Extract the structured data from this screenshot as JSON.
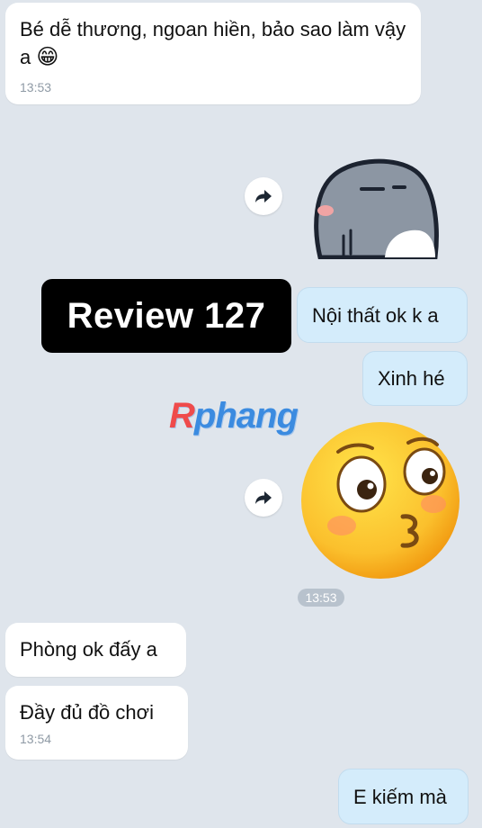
{
  "messages": {
    "m1": {
      "text": "Bé dễ thương, ngoan hiền, bảo sao làm vậy a",
      "emoji": "😁",
      "time": "13:53"
    },
    "m2": {
      "text": "Nội thất ok k a"
    },
    "m3": {
      "text": "Xinh hé"
    },
    "m4": {
      "text": "Phòng ok đấy a"
    },
    "m5": {
      "text": "Đầy đủ đồ chơi",
      "time": "13:54"
    },
    "m6": {
      "text": "E kiếm mà"
    }
  },
  "center_time": "13:53",
  "overlay_label": "Review 127",
  "watermark": {
    "first": "R",
    "rest": "phang"
  },
  "icons": {
    "share": "share-arrow-icon",
    "sticker": "gray-seal-sticker",
    "emoji": "kissing-face-emoji"
  },
  "colors": {
    "background": "#dfe5ec",
    "incoming_bubble": "#ffffff",
    "outgoing_bubble": "#d4ecfb",
    "overlay": "#000000"
  }
}
